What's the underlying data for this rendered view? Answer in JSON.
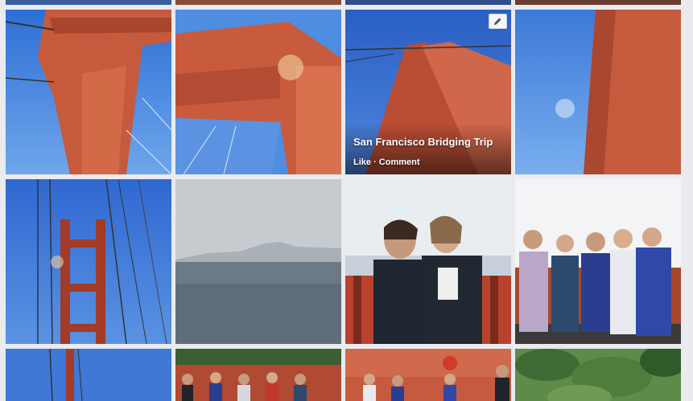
{
  "album": {
    "caption": {
      "title": "San Francisco Bridging Trip",
      "like_label": "Like",
      "separator": " · ",
      "comment_label": "Comment"
    }
  },
  "photos": [
    {
      "name": "bridge-tower-top-left"
    },
    {
      "name": "bridge-tower-crossbeam"
    },
    {
      "name": "bridge-tower-looking-up"
    },
    {
      "name": "bridge-tower-side"
    },
    {
      "name": "bridge-tower-cables"
    },
    {
      "name": "bay-skyline-fog"
    },
    {
      "name": "two-women-on-bridge"
    },
    {
      "name": "group-of-girls"
    },
    {
      "name": "bridge-tower-partial"
    },
    {
      "name": "group-at-railing"
    },
    {
      "name": "group-with-crab-hat"
    },
    {
      "name": "green-hillside"
    }
  ],
  "icons": {
    "edit": "pencil-icon"
  },
  "colors": {
    "page_bg": "#e9ebee",
    "sky": "#4a83d4",
    "bridge": "#c8553a"
  }
}
